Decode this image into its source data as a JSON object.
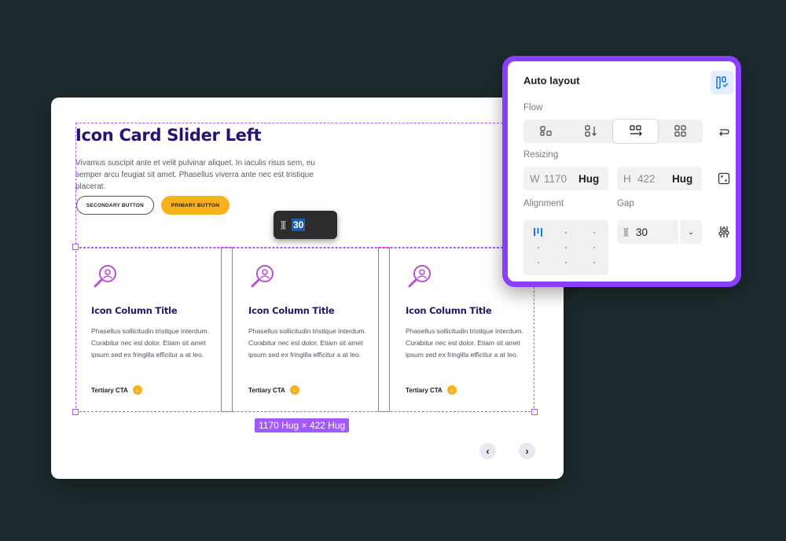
{
  "canvas": {
    "title": "Icon Card Slider Left",
    "description": "Vivamus suscipit ante et velit pulvinar aliquet. In iaculis risus sem, eu semper arcu feugiat sit amet. Phasellus viverra ante nec est tristique placerat.",
    "secondary_button": "SECONDARY BUTTON",
    "primary_button": "PRIMARY BUTTON",
    "gap_pill_value": "30",
    "size_label": "1170 Hug × 422 Hug",
    "cards": [
      {
        "title": "Icon Column Title",
        "body": "Phasellus sollicitudin tristique interdum. Curabitur nec est dolor. Etiam sit amet ipsum sed ex fringilla efficitur a at leo.",
        "cta": "Tertiary CTA"
      },
      {
        "title": "Icon Column Title",
        "body": "Phasellus sollicitudin tristique interdum. Curabitur nec est dolor. Etiam sit amet ipsum sed ex fringilla efficitur a at leo.",
        "cta": "Tertiary CTA"
      },
      {
        "title": "Icon Column Title",
        "body": "Phasellus sollicitudin tristique interdum. Curabitur nec est dolor. Etiam sit amet ipsum sed ex fringilla efficitur a at leo.",
        "cta": "Tertiary CTA"
      }
    ],
    "nav_prev": "‹",
    "nav_next": "›",
    "colors": {
      "brand_purple": "#2a1272",
      "accent_yellow": "#f7b21b",
      "selection": "#a259ff",
      "gap_highlight": "#e043e8"
    }
  },
  "panel": {
    "title": "Auto layout",
    "flow_label": "Flow",
    "resizing_label": "Resizing",
    "width_prefix": "W",
    "width_value": "1170",
    "width_mode": "Hug",
    "height_prefix": "H",
    "height_value": "422",
    "height_mode": "Hug",
    "alignment_label": "Alignment",
    "gap_label": "Gap",
    "gap_value": "30",
    "flow_active": "horizontal",
    "colors": {
      "panel_border": "#8a3ffc",
      "active_blue": "#1a73e8"
    }
  }
}
